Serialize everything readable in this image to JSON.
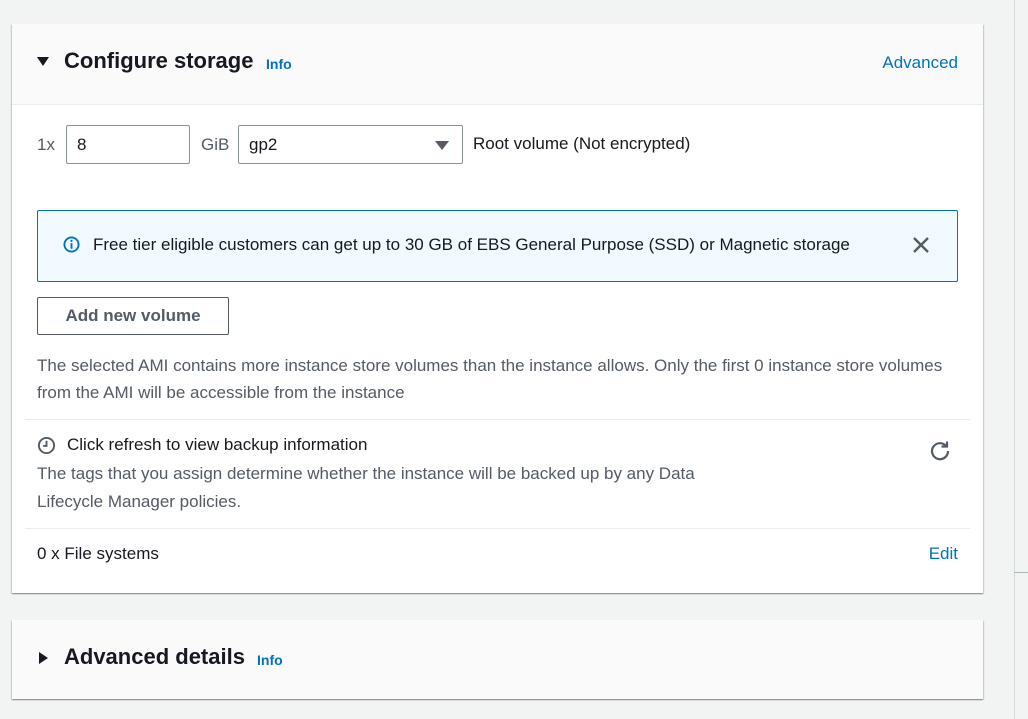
{
  "configure_storage": {
    "title": "Configure storage",
    "info_label": "Info",
    "advanced_label": "Advanced",
    "volume": {
      "count_label": "1x",
      "size_value": "8",
      "size_unit": "GiB",
      "volume_type": "gp2",
      "description": "Root volume  (Not encrypted)"
    },
    "alert": {
      "message": "Free tier eligible customers can get up to 30 GB of EBS General Purpose (SSD) or Magnetic storage",
      "icon": "info-circle-icon",
      "close_icon": "close-icon"
    },
    "add_volume_label": "Add new volume",
    "ami_message": "The selected AMI contains more instance store volumes than the instance allows. Only the first 0 instance store volumes from the AMI will be accessible from the instance",
    "backup": {
      "title": "Click refresh to view backup information",
      "description": "The tags that you assign determine whether the instance will be backed up by any Data Lifecycle Manager policies.",
      "icon": "clock-icon",
      "refresh_icon": "refresh-icon"
    },
    "file_systems": {
      "label": "0 x File systems",
      "edit_label": "Edit"
    }
  },
  "advanced_details": {
    "title": "Advanced details",
    "info_label": "Info"
  },
  "colors": {
    "link": "#0073bb",
    "alert_background": "#f1faff",
    "alert_border": "#0073bb",
    "page_background": "#f2f3f3",
    "text_primary": "#16191f",
    "text_secondary": "#545b64"
  }
}
